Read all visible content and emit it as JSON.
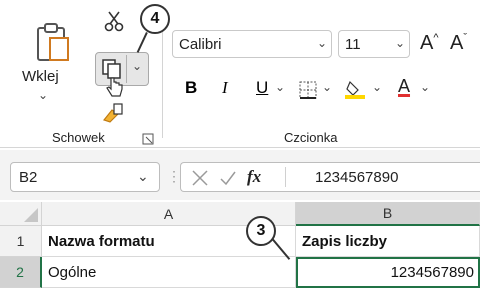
{
  "ribbon": {
    "paste_label": "Wklej",
    "clipboard_group_label": "Schowek",
    "font_group_label": "Czcionka",
    "font_name": "Calibri",
    "font_size": "11",
    "grow_font": "A",
    "shrink_font": "A",
    "bold": "B",
    "italic": "I",
    "underline": "U"
  },
  "formula_bar": {
    "name_box": "B2",
    "fx": "fx",
    "value": "1234567890"
  },
  "sheet": {
    "columns": [
      "A",
      "B"
    ],
    "rows": [
      {
        "num": "1",
        "a": "Nazwa formatu",
        "b": "Zapis liczby"
      },
      {
        "num": "2",
        "a": "Ogólne",
        "b": "1234567890"
      }
    ]
  },
  "callouts": [
    "4",
    "3"
  ],
  "colors": {
    "highlight": "#ffd700",
    "font_color": "#e03030",
    "selected_cell_border": "#217346",
    "selected_header_bg": "#d2d2d2"
  }
}
